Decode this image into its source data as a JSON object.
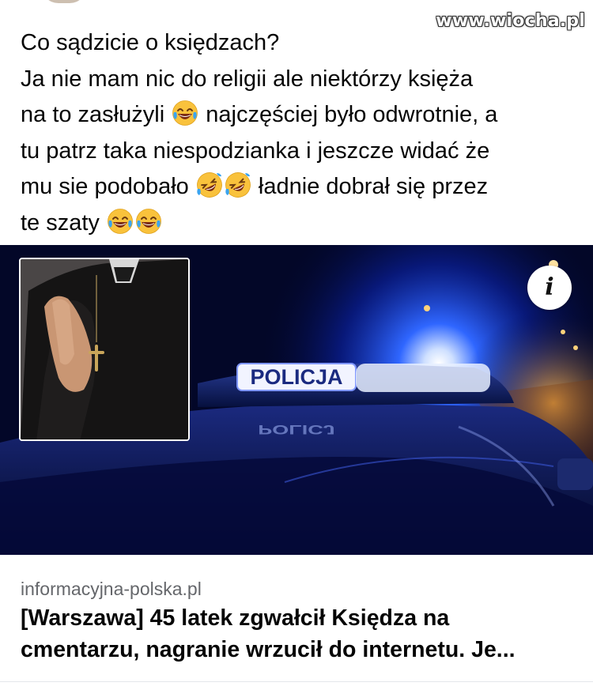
{
  "watermark": "www.wiocha.pl",
  "post": {
    "lines": [
      {
        "text": "Co sądzicie o księdzach?",
        "emojis_after": []
      },
      {
        "text": "Ja nie mam nic do religii ale niektórzy księża",
        "emojis_after": []
      },
      {
        "pre": "na to zasłużyli ",
        "emoji": "tears-of-joy",
        "post": " najczęściej było odwrotnie, a"
      },
      {
        "text": "tu patrz taka niespodzianka i jeszcze widać że",
        "emojis_after": []
      },
      {
        "pre": "mu sie podobało ",
        "emoji": "rolling-on-floor-laughing x2",
        "post": " ładnie dobrał się przez"
      },
      {
        "pre": "te szaty ",
        "emoji": "tears-of-joy x2",
        "post": ""
      }
    ]
  },
  "link_preview": {
    "image_sign_text": "POLICJA",
    "reflection_text": "POLICJ",
    "info_button_label": "i",
    "domain": "informacyjna-polska.pl",
    "title_line1": "[Warszawa] 45 latek zgwałcił Księdza na",
    "title_line2": "cmentarzu, nagranie wrzucił do internetu. Je..."
  },
  "colors": {
    "text": "#050505",
    "secondary_text": "#65676b",
    "police_blue": "#1a4dff",
    "night_sky": "#020626"
  }
}
